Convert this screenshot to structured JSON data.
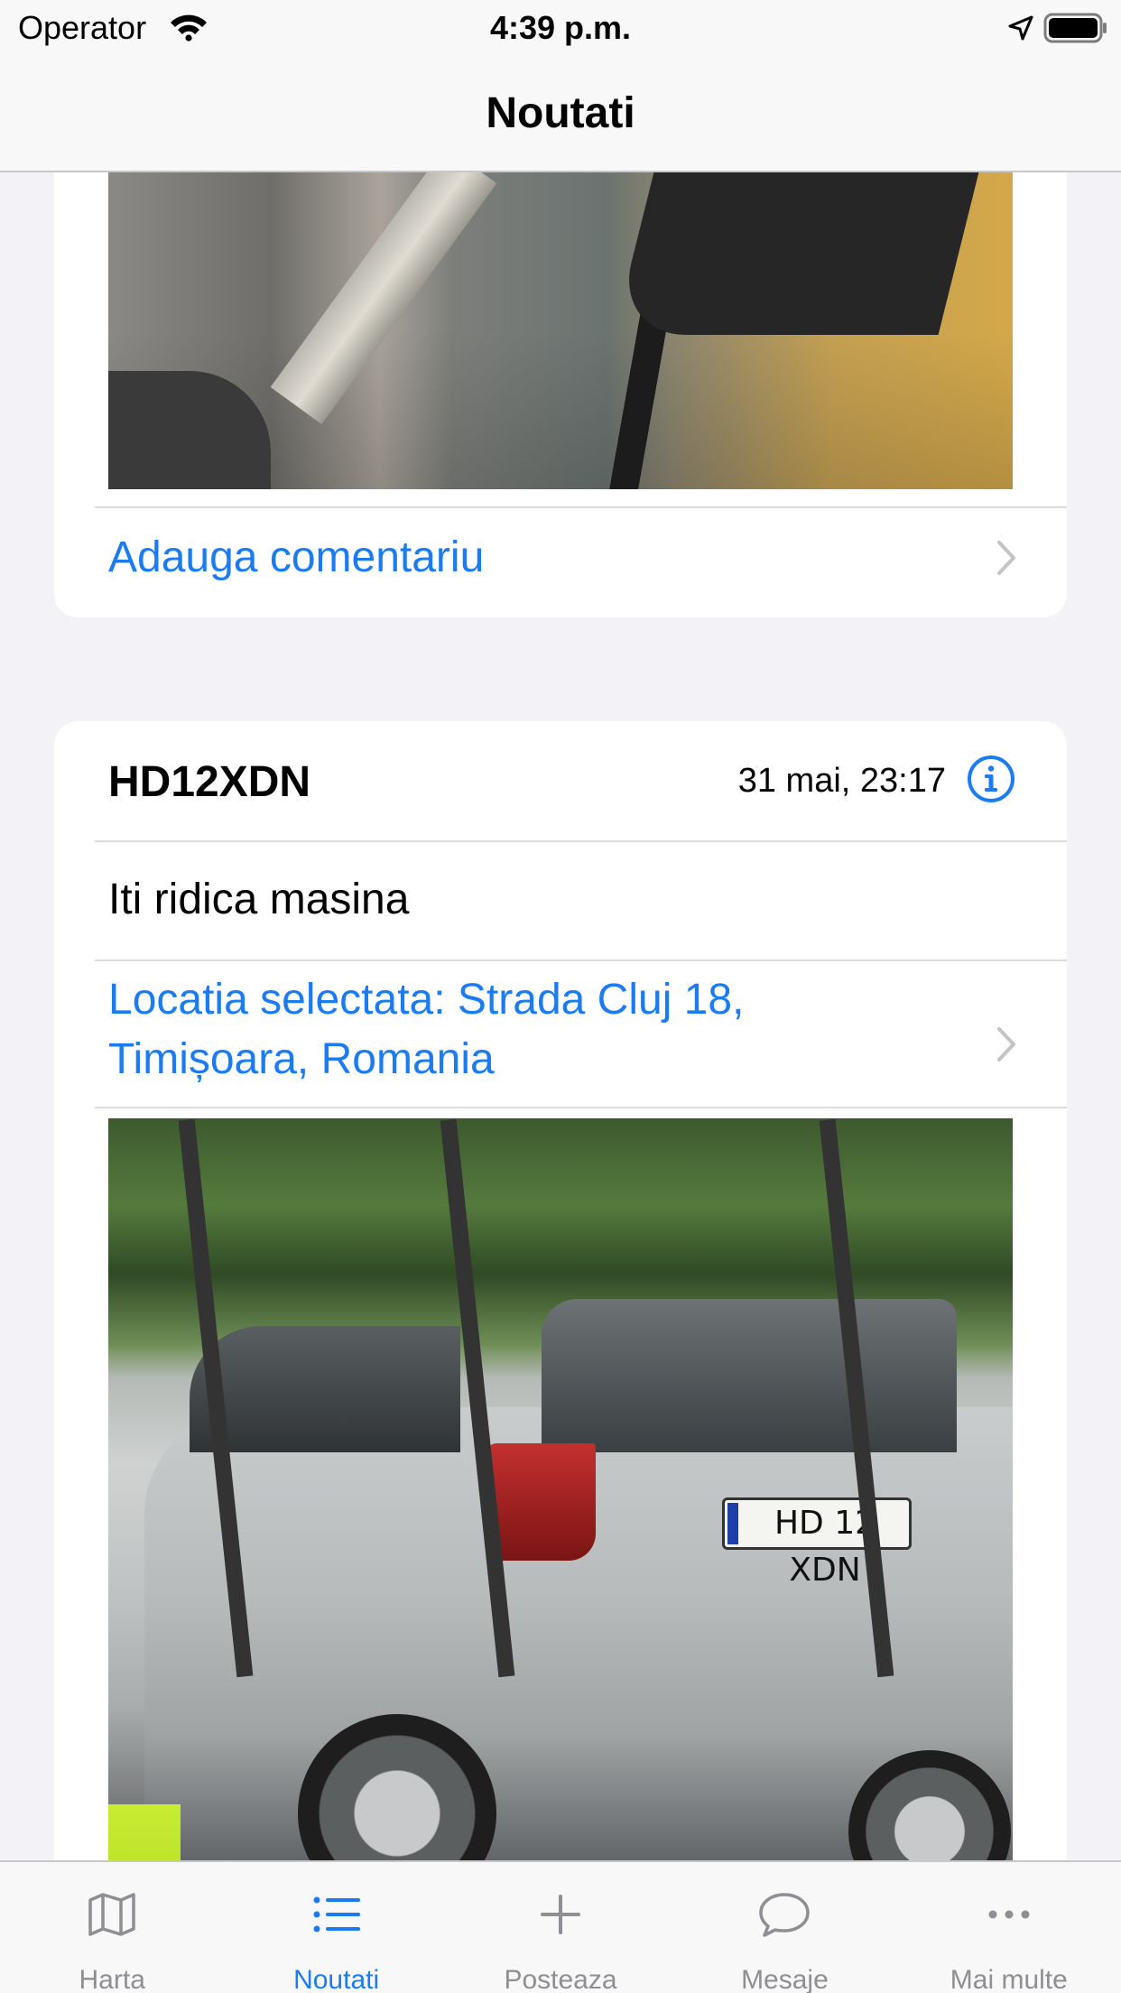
{
  "status_bar": {
    "carrier": "Operator",
    "time": "4:39 p.m."
  },
  "nav": {
    "title": "Noutati"
  },
  "feed": {
    "card_1": {
      "add_comment_label": "Adauga comentariu"
    },
    "card_2": {
      "plate": "HD12XDN",
      "date": "31 mai, 23:17",
      "text": "Iti ridica masina",
      "location_line_1": "Locatia selectata: Strada Cluj 18,",
      "location_line_2": "Timișoara, Romania",
      "photo_plate_text": "HD 12 XDN"
    }
  },
  "tabbar": {
    "active": "Noutati",
    "items": [
      {
        "label": "Harta",
        "icon": "map-icon"
      },
      {
        "label": "Noutati",
        "icon": "list-icon"
      },
      {
        "label": "Posteaza",
        "icon": "plus-icon"
      },
      {
        "label": "Mesaje",
        "icon": "chat-bubble-icon"
      },
      {
        "label": "Mai multe",
        "icon": "more-icon"
      }
    ]
  },
  "colors": {
    "accent": "#1a7cf0",
    "inactive_tab": "#8e8e93",
    "background": "#f2f2f7"
  }
}
